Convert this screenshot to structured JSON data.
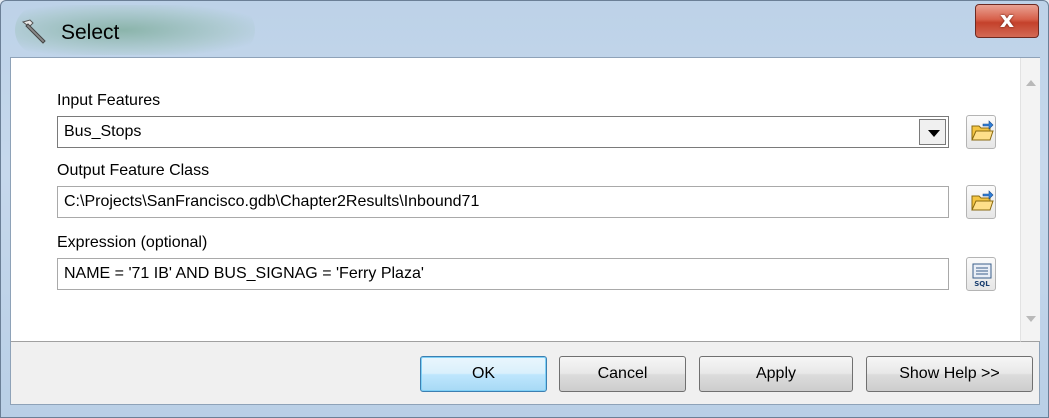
{
  "window": {
    "title": "Select",
    "app_icon": "hammer-icon",
    "close_label": "x"
  },
  "form": {
    "input_features": {
      "label": "Input Features",
      "value": "Bus_Stops",
      "browse_icon": "folder-open-icon"
    },
    "output_feature_class": {
      "label": "Output Feature Class",
      "value": "C:\\Projects\\SanFrancisco.gdb\\Chapter2Results\\Inbound71",
      "browse_icon": "folder-open-icon"
    },
    "expression": {
      "label": "Expression (optional)",
      "value": "NAME = '71 IB' AND BUS_SIGNAG = 'Ferry Plaza'",
      "sql_icon": "sql-icon",
      "sql_label": "SQL"
    }
  },
  "buttons": {
    "ok": "OK",
    "cancel": "Cancel",
    "apply": "Apply",
    "help": "Show Help >>"
  },
  "colors": {
    "close_button": "#c4412b",
    "default_button": "#3c7fb1",
    "title_bar": "#bdd2e8"
  }
}
